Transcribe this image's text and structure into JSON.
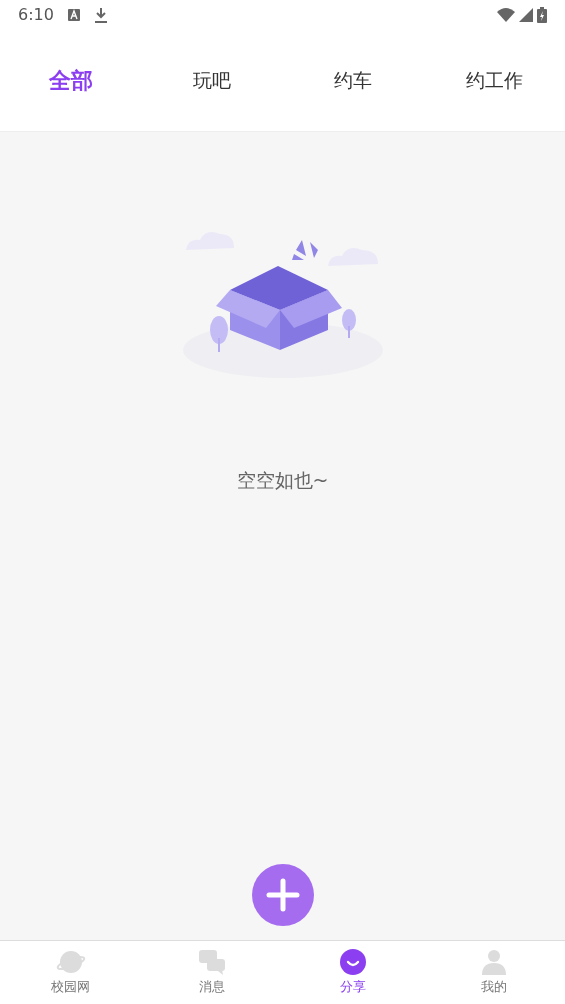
{
  "status_bar": {
    "time": "6:10"
  },
  "tabs": [
    {
      "label": "全部",
      "selected": true
    },
    {
      "label": "玩吧",
      "selected": false
    },
    {
      "label": "约车",
      "selected": false
    },
    {
      "label": "约工作",
      "selected": false
    }
  ],
  "empty_state": {
    "message": "空空如也~"
  },
  "nav": [
    {
      "label": "校园网",
      "kind": "planet",
      "selected": false
    },
    {
      "label": "消息",
      "kind": "chat",
      "selected": false
    },
    {
      "label": "分享",
      "kind": "smile",
      "selected": true
    },
    {
      "label": "我的",
      "kind": "person",
      "selected": false
    }
  ]
}
